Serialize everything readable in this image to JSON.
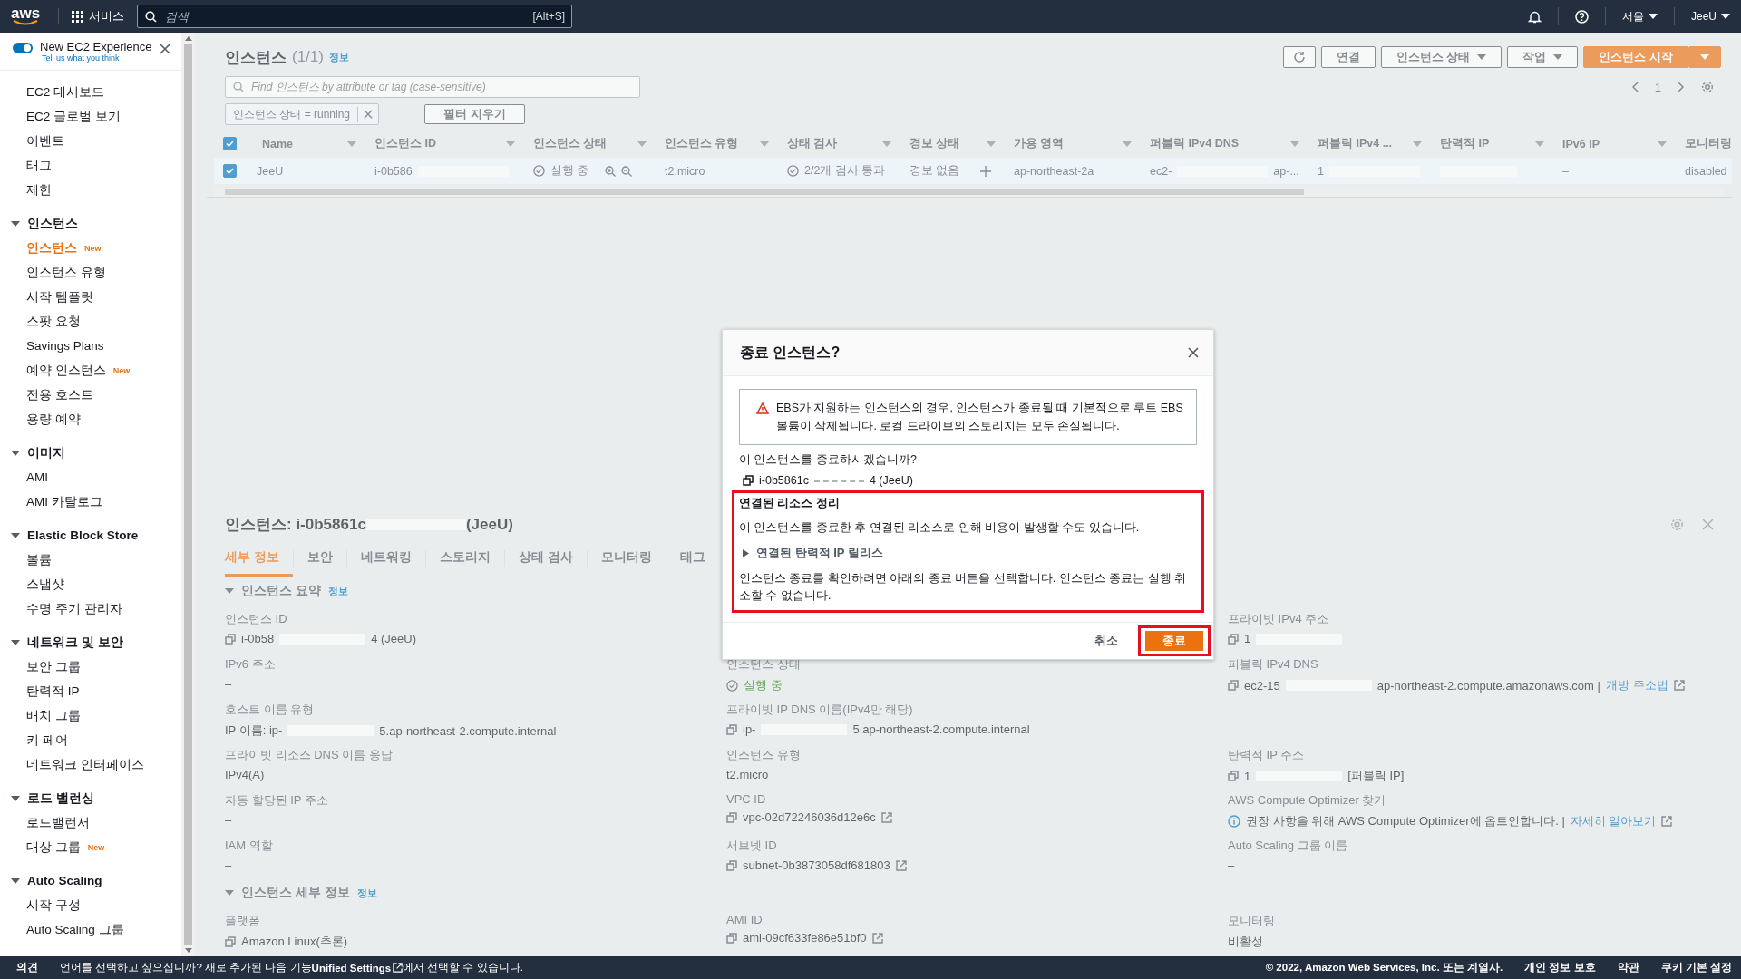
{
  "top_nav": {
    "logo": "aws",
    "services": "서비스",
    "search": {
      "placeholder": "검색",
      "shortcut": "[Alt+S]"
    },
    "region": "서울",
    "user": "JeeU"
  },
  "sidebar": {
    "experience_toggle": {
      "label": "New EC2 Experience",
      "on": true,
      "link": "Tell us what you think"
    },
    "items": [
      {
        "label": "EC2 대시보드",
        "selected": false
      },
      {
        "label": "EC2 글로벌 보기",
        "selected": false
      },
      {
        "label": "이벤트",
        "selected": false
      },
      {
        "label": "태그",
        "selected": false
      },
      {
        "label": "제한",
        "selected": false
      }
    ],
    "sections": [
      {
        "title": "인스턴스",
        "expanded": true,
        "items": [
          {
            "label": "인스턴스",
            "selected": true,
            "badge": "New"
          },
          {
            "label": "인스턴스 유형",
            "selected": false
          },
          {
            "label": "시작 템플릿",
            "selected": false
          },
          {
            "label": "스팟 요청",
            "selected": false
          },
          {
            "label": "Savings Plans",
            "selected": false
          },
          {
            "label": "예약 인스턴스",
            "selected": false,
            "badge": "New"
          },
          {
            "label": "전용 호스트",
            "selected": false
          },
          {
            "label": "용량 예약",
            "selected": false
          }
        ]
      },
      {
        "title": "이미지",
        "expanded": true,
        "items": [
          {
            "label": "AMI",
            "selected": false
          },
          {
            "label": "AMI 카탈로그",
            "selected": false
          }
        ]
      },
      {
        "title": "Elastic Block Store",
        "expanded": true,
        "items": [
          {
            "label": "볼륨",
            "selected": false
          },
          {
            "label": "스냅샷",
            "selected": false
          },
          {
            "label": "수명 주기 관리자",
            "selected": false
          }
        ]
      },
      {
        "title": "네트워크 및 보안",
        "expanded": true,
        "items": [
          {
            "label": "보안 그룹",
            "selected": false
          },
          {
            "label": "탄력적 IP",
            "selected": false
          },
          {
            "label": "배치 그룹",
            "selected": false
          },
          {
            "label": "키 페어",
            "selected": false
          },
          {
            "label": "네트워크 인터페이스",
            "selected": false
          }
        ]
      },
      {
        "title": "로드 밸런싱",
        "expanded": true,
        "items": [
          {
            "label": "로드밸런서",
            "selected": false
          },
          {
            "label": "대상 그룹",
            "selected": false,
            "badge": "New"
          }
        ]
      },
      {
        "title": "Auto Scaling",
        "expanded": true,
        "items": [
          {
            "label": "시작 구성",
            "selected": false
          },
          {
            "label": "Auto Scaling 그룹",
            "selected": false
          }
        ]
      }
    ]
  },
  "instances_panel": {
    "title": "인스턴스",
    "count": "(1/1)",
    "info": "정보",
    "buttons": [
      {
        "label": "연결",
        "kind": "plain"
      },
      {
        "label": "인스턴스 상태",
        "kind": "dropdown"
      },
      {
        "label": "작업",
        "kind": "dropdown"
      },
      {
        "label": "인스턴스 시작",
        "kind": "primary"
      }
    ],
    "search": {
      "placeholder": "Find 인스턴스 by attribute or tag (case-sensitive)"
    },
    "filter_chip": "인스턴스 상태 = running",
    "clear_filters": "필터 지우기",
    "page": "1",
    "table": {
      "all_checked": true,
      "columns": [
        "Name",
        "인스턴스 ID",
        "인스턴스 상태",
        "인스턴스 유형",
        "상태 검사",
        "경보 상태",
        "가용 영역",
        "퍼블릭 IPv4 DNS",
        "퍼블릭 IPv4 ...",
        "탄력적 IP",
        "IPv6 IP",
        "모니터링"
      ],
      "rows": [
        {
          "checked": true,
          "cells": [
            {
              "text": "JeeU"
            },
            {
              "text": "i-0b586",
              "redacted": true
            },
            {
              "text": "실행 중",
              "kind": "running"
            },
            {
              "text": "t2.micro"
            },
            {
              "text": "2/2개 검사 통과",
              "kind": "check"
            },
            {
              "text": "경보 없음",
              "kind": "alarm"
            },
            {
              "text": "ap-northeast-2a"
            },
            {
              "text": "ec2-",
              "redacted": true,
              "after": "ap-..."
            },
            {
              "text": "1",
              "redacted": true
            },
            {
              "redacted": true
            },
            {
              "text": "–"
            },
            {
              "text": "disabled"
            }
          ]
        }
      ]
    }
  },
  "details_panel": {
    "title": "인스턴스: i-0b5861c",
    "redacted": true,
    "title_after": "(JeeU)",
    "tabs": [
      {
        "label": "세부 정보",
        "selected": true
      },
      {
        "label": "보안",
        "selected": false
      },
      {
        "label": "네트워킹",
        "selected": false
      },
      {
        "label": "스토리지",
        "selected": false
      },
      {
        "label": "상태 검사",
        "selected": false
      },
      {
        "label": "모니터링",
        "selected": false
      },
      {
        "label": "태그",
        "selected": false
      }
    ],
    "sections": [
      {
        "title": "인스턴스 요약",
        "info": "정보",
        "expanded": true,
        "columns": [
          [
            {
              "label": "인스턴스 ID",
              "value": "i-0b58",
              "redacted": true,
              "value_after": "4 (JeeU)",
              "copy": true
            },
            {
              "label": "IPv6 주소",
              "value": "–"
            },
            {
              "label": "호스트 이름 유형",
              "value": "IP 이름: ip-",
              "redacted": true,
              "value_after": "5.ap-northeast-2.compute.internal"
            },
            {
              "label": "프라이빗 리소스 DNS 이름 응답",
              "value": "IPv4(A)"
            },
            {
              "label": "자동 할당된 IP 주소",
              "value": "–"
            },
            {
              "label": "IAM 역할",
              "value": "–"
            }
          ],
          [
            {
              "label": "인스턴스 상태",
              "value": "실행 중",
              "kind": "running",
              "gap_before": true
            },
            {
              "label": "프라이빗 IP DNS 이름(IPv4만 해당)",
              "value": "ip-",
              "redacted": true,
              "value_after": "5.ap-northeast-2.compute.internal",
              "copy": true
            },
            {
              "label": "인스턴스 유형",
              "value": "t2.micro"
            },
            {
              "label": "VPC ID",
              "value": "vpc-02d72246036d12e6c",
              "kind": "link",
              "copy": true
            },
            {
              "label": "서브넷 ID",
              "value": "subnet-0b3873058df681803",
              "kind": "link",
              "copy": true
            }
          ],
          [
            {
              "label": "프라이빗 IPv4 주소",
              "value": "1",
              "redacted": true,
              "copy": true
            },
            {
              "label": "퍼블릭 IPv4 DNS",
              "value": "ec2-15",
              "redacted": true,
              "value_after": "ap-northeast-2.compute.amazonaws.com |",
              "link": "개방 주소법",
              "copy": true
            },
            {
              "label": "탄력적 IP 주소",
              "value": "1",
              "redacted": true,
              "value_after": "[퍼블릭 IP]",
              "copy": true,
              "gap_before": true
            },
            {
              "label": "AWS Compute Optimizer 찾기",
              "value": "권장 사항을 위해 AWS Compute Optimizer에 옵트인합니다. |",
              "kind": "info",
              "link": "자세히 알아보기"
            },
            {
              "label": "Auto Scaling 그룹 이름",
              "value": "–"
            }
          ]
        ]
      },
      {
        "title": "인스턴스 세부 정보",
        "info": "정보",
        "expanded": true,
        "columns": [
          [
            {
              "label": "플랫폼",
              "value": "Amazon Linux(추론)",
              "copy": true
            }
          ],
          [
            {
              "label": "AMI ID",
              "value": "ami-09cf633fe86e51bf0",
              "kind": "link",
              "copy": true
            }
          ],
          [
            {
              "label": "모니터링",
              "value": "비활성"
            }
          ]
        ]
      }
    ]
  },
  "dialog": {
    "title": "종료 인스턴스?",
    "warning": "EBS가 지원하는 인스턴스의 경우, 인스턴스가 종료될 때 기본적으로 루트 EBS 볼륨이 삭제됩니다. 로컬 드라이브의 스토리지는 모두 손실됩니다.",
    "question": "이 인스턴스를 종료하시겠습니까?",
    "instance": {
      "id": "i-0b5861c",
      "redacted": true,
      "after": "4 (JeeU)"
    },
    "cleanup": {
      "title": "연결된 리소스 정리",
      "text": "이 인스턴스를 종료한 후 연결된 리소스로 인해 비용이 발생할 수도 있습니다.",
      "expander": {
        "label": "연결된 탄력적 IP 릴리스",
        "expanded": false
      },
      "note": "인스턴스 종료를 확인하려면 아래의 종료 버튼을 선택합니다. 인스턴스 종료는 실행 취소할 수 없습니다."
    },
    "cancel": "취소",
    "confirm": "종료"
  },
  "footer": {
    "feedback": "의견",
    "message_before": "언어를 선택하고 싶으십니까? 새로 추가된 다음 기능",
    "message_link": "Unified Settings",
    "message_after": "에서 선택할 수 있습니다.",
    "copyright": "© 2022, Amazon Web Services, Inc. 또는 계열사.",
    "links": [
      "개인 정보 보호",
      "약관",
      "쿠키 기본 설정"
    ]
  }
}
